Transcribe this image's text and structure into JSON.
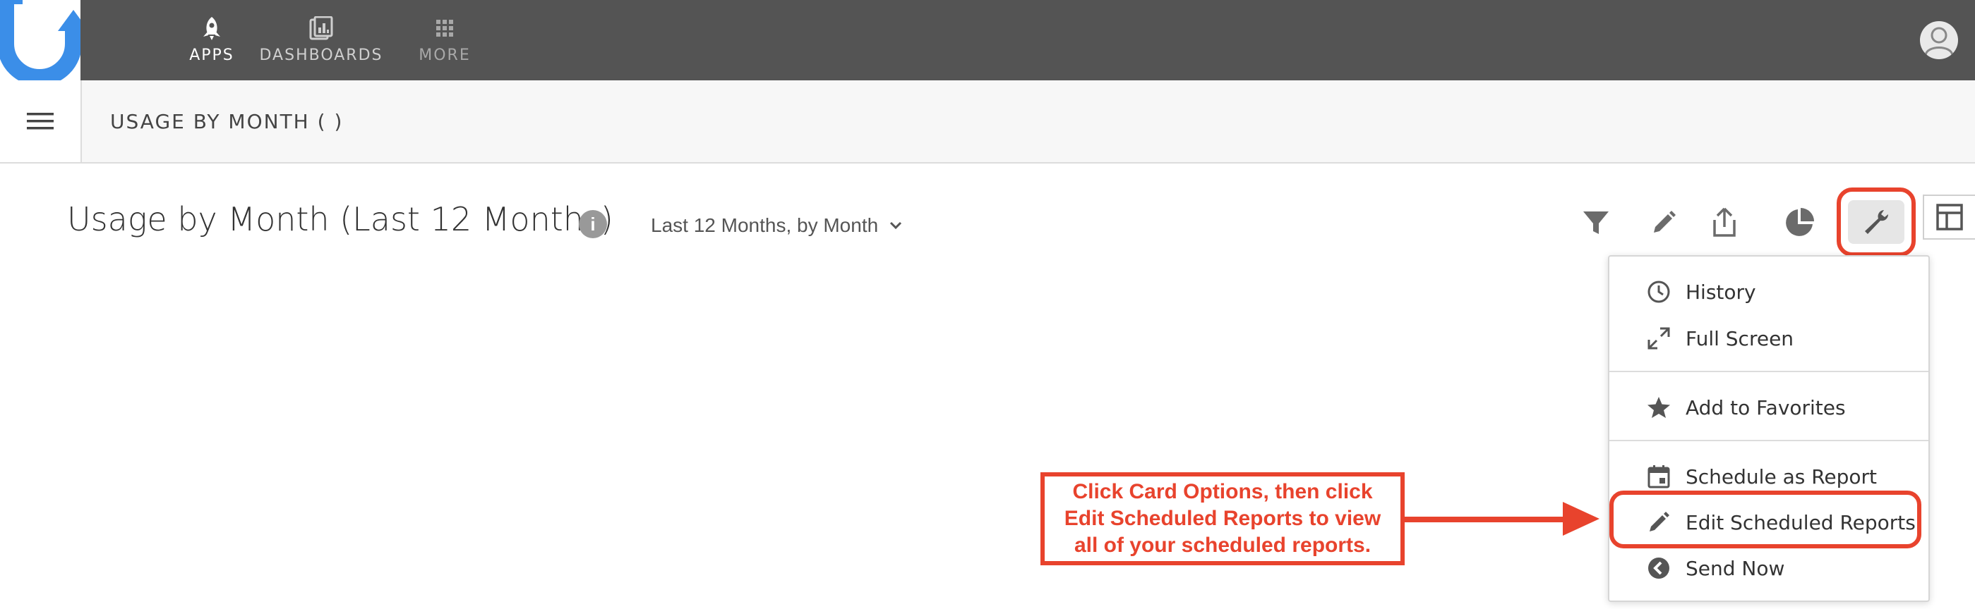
{
  "nav": {
    "items": [
      {
        "label": "APPS",
        "icon": "rocket-icon"
      },
      {
        "label": "DASHBOARDS",
        "icon": "dashboard-icon"
      },
      {
        "label": "MORE",
        "icon": "grid-icon"
      }
    ]
  },
  "header": {
    "page_title": "USAGE BY MONTH ( )"
  },
  "card": {
    "title": "Usage by Month (Last 12 Months)",
    "info_glyph": "i",
    "range_label": "Last 12 Months, by Month"
  },
  "options_menu": {
    "items": [
      {
        "label": "History",
        "icon": "clock-icon"
      },
      {
        "label": "Full Screen",
        "icon": "expand-icon"
      },
      {
        "label": "Add to Favorites",
        "icon": "star-icon"
      },
      {
        "label": "Schedule as Report",
        "icon": "calendar-icon"
      },
      {
        "label": "Edit Scheduled Reports",
        "icon": "pencil-icon"
      },
      {
        "label": "Send Now",
        "icon": "send-icon"
      }
    ]
  },
  "callout": {
    "line1": "Click Card Options, then click",
    "line2": "Edit Scheduled Reports to view",
    "line3": "all of your scheduled reports."
  },
  "colors": {
    "topbar": "#545454",
    "brand_blue": "#3b8ee8",
    "annotation_red": "#e8432d"
  }
}
